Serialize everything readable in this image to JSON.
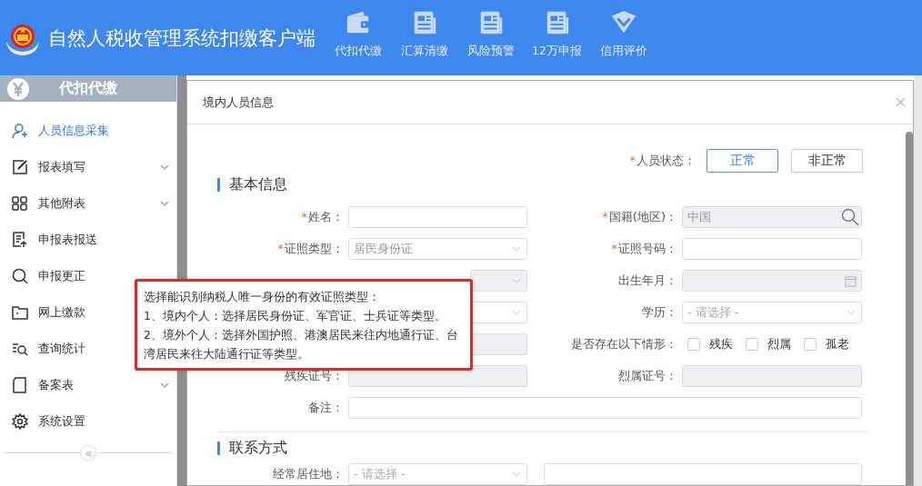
{
  "header": {
    "title": "自然人税收管理系统扣缴客户端",
    "nav": [
      {
        "label": "代扣代缴",
        "kind": "wallet"
      },
      {
        "label": "汇算清缴",
        "kind": "document"
      },
      {
        "label": "风险预警",
        "kind": "document"
      },
      {
        "label": "12万申报",
        "kind": "document"
      },
      {
        "label": "信用评价",
        "kind": "diamond"
      }
    ]
  },
  "sidebar": {
    "title": "代扣代缴",
    "items": [
      {
        "label": "人员信息采集",
        "kind": "person",
        "expandable": false,
        "selected": true
      },
      {
        "label": "报表填写",
        "kind": "edit",
        "expandable": true,
        "selected": false
      },
      {
        "label": "其他附表",
        "kind": "grid",
        "expandable": true,
        "selected": false
      },
      {
        "label": "申报表报送",
        "kind": "report",
        "expandable": false,
        "selected": false
      },
      {
        "label": "申报更正",
        "kind": "search",
        "expandable": false,
        "selected": false
      },
      {
        "label": "网上缴款",
        "kind": "folder",
        "selected": false
      },
      {
        "label": "查询统计",
        "kind": "query",
        "selected": false
      },
      {
        "label": "备案表",
        "kind": "file",
        "expandable": true,
        "selected": false
      },
      {
        "label": "系统设置",
        "kind": "settings",
        "expandable": false,
        "selected": false
      }
    ]
  },
  "dialog": {
    "title": "境内人员信息",
    "status": {
      "required_mark": "*",
      "label": "人员状态：",
      "options": [
        {
          "label": "正常",
          "selected": true
        },
        {
          "label": "非正常",
          "selected": false
        }
      ]
    },
    "sections": [
      {
        "title": "基本信息",
        "rows": [
          [
            {
              "required_mark": "*",
              "label": "姓名：",
              "kind": "text",
              "disabled": false
            },
            {
              "required_mark": "*",
              "label": "国籍(地区)：",
              "kind": "search",
              "value": "中国",
              "disabled": true
            }
          ],
          [
            {
              "required_mark": "*",
              "label": "证照类型：",
              "kind": "select",
              "value": "居民身份证",
              "disabled": false
            },
            {
              "required_mark": "*",
              "label": "证照号码：",
              "kind": "text",
              "disabled": false
            }
          ],
          [
            {
              "kind": "select",
              "disabled": true
            },
            {
              "label": "出生年月：",
              "kind": "date",
              "disabled": true
            }
          ],
          [
            {
              "kind": "select",
              "disabled": false
            },
            {
              "label": "学历：",
              "kind": "select",
              "placeholder": "- 请选择 -",
              "disabled": false
            }
          ],
          [
            {
              "kind": "text",
              "disabled": true
            },
            {
              "label": "是否存在以下情形：",
              "kind": "checks",
              "options": [
                {
                  "label": "残疾",
                  "checked": false
                },
                {
                  "label": "烈属",
                  "checked": false
                },
                {
                  "label": "孤老",
                  "checked": false
                }
              ]
            }
          ],
          [
            {
              "label": "残疾证号：",
              "kind": "text",
              "disabled": true
            },
            {
              "label": "烈属证号：",
              "kind": "text",
              "disabled": true
            }
          ],
          [
            {
              "label": "备注：",
              "kind": "wide",
              "disabled": false
            }
          ]
        ]
      },
      {
        "title": "联系方式",
        "rows": [
          [
            {
              "label": "经常居住地：",
              "kind": "select",
              "placeholder": "- 请选择 -",
              "disabled": false
            },
            {
              "kind": "detail",
              "disabled": false
            }
          ]
        ]
      }
    ],
    "tooltip": {
      "lines": [
        "选择能识别纳税人唯一身份的有效证照类型：",
        "1、境内个人：选择居民身份证、军官证、士兵证等类型。",
        "2、境外个人：选择外国护照、港澳居民来往内地通行证、台湾居民来往大陆通行证等类型。"
      ]
    }
  }
}
